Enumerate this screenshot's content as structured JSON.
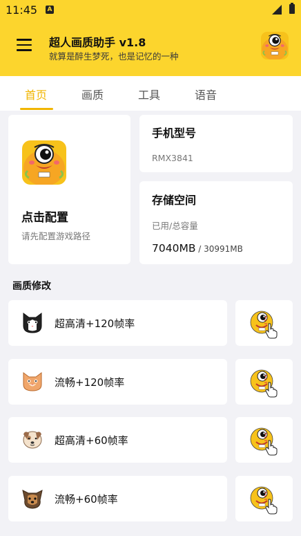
{
  "status_bar": {
    "time": "11:45",
    "notification_letter": "A"
  },
  "header": {
    "title": "超人画质助手 v1.8",
    "subtitle": "就算是醉生梦死，也是记忆的一种",
    "avatar_badge": "极铃"
  },
  "tabs": [
    {
      "label": "首页",
      "active": true
    },
    {
      "label": "画质",
      "active": false
    },
    {
      "label": "工具",
      "active": false
    },
    {
      "label": "语音",
      "active": false
    }
  ],
  "config_card": {
    "title": "点击配置",
    "description": "请先配置游戏路径",
    "logo_badge": "极铃"
  },
  "phone_card": {
    "title": "手机型号",
    "model": "RMX3841"
  },
  "storage_card": {
    "title": "存储空间",
    "label": "已用/总容量",
    "used": "7040MB",
    "total": " / 30991MB"
  },
  "section": {
    "title": "画质修改"
  },
  "quality_options": [
    {
      "label": "超高清+120帧率",
      "icon": "tuxedo-cat-icon"
    },
    {
      "label": "流畅+120帧率",
      "icon": "orange-cat-icon"
    },
    {
      "label": "超高清+60帧率",
      "icon": "beige-dog-icon"
    },
    {
      "label": "流畅+60帧率",
      "icon": "yorkie-dog-icon"
    }
  ],
  "colors": {
    "accent": "#FCD52D",
    "tab_active": "#F1B500",
    "background": "#F2F2F6"
  }
}
